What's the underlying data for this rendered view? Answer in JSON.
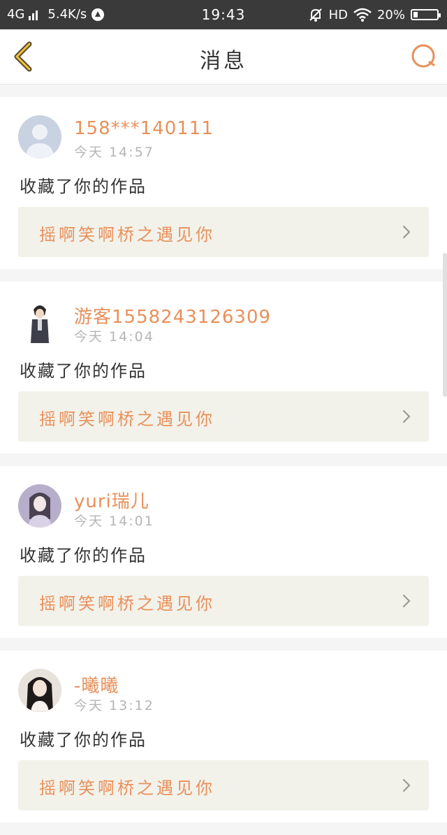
{
  "status_bar": {
    "network": "4G",
    "speed": "5.4K/s",
    "time": "19:43",
    "hd": "HD",
    "battery": "20%",
    "battery_level": 0.2
  },
  "header": {
    "title": "消息"
  },
  "messages": [
    {
      "name": "158***140111",
      "time": "今天 14:57",
      "text": "收藏了你的作品",
      "work": "摇啊笑啊桥之遇见你"
    },
    {
      "name": "游客1558243126309",
      "time": "今天 14:04",
      "text": "收藏了你的作品",
      "work": "摇啊笑啊桥之遇见你"
    },
    {
      "name": "yuri瑞儿",
      "time": "今天 14:01",
      "text": "收藏了你的作品",
      "work": "摇啊笑啊桥之遇见你"
    },
    {
      "name": "-曦曦",
      "time": "今天 13:12",
      "text": "收藏了你的作品",
      "work": "摇啊笑啊桥之遇见你"
    }
  ],
  "colors": {
    "accent": "#e8905a",
    "status_bar_bg": "#3a3a3a",
    "link_bg": "#f2f2ea"
  },
  "icons": [
    "back-icon",
    "search-icon",
    "chevron-right-icon",
    "wifi-icon",
    "mute-icon",
    "battery-icon"
  ]
}
